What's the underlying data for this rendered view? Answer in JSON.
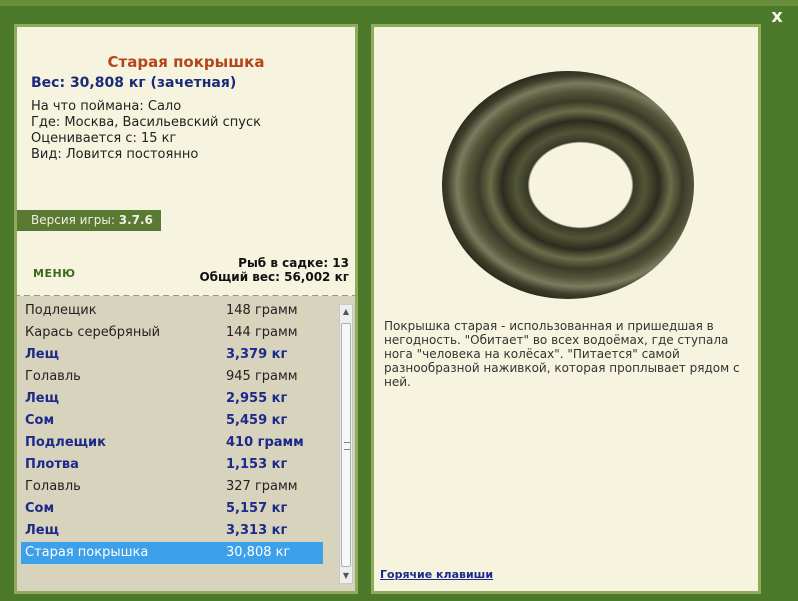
{
  "window": {
    "close_label": "x"
  },
  "fish": {
    "title": "Старая покрышка",
    "weight": "Вес: 30,808 кг (зачетная)",
    "bait": "На что поймана: Сало",
    "place": "Где: Москва, Васильевский спуск",
    "valued_from": "Оценивается с: 15 кг",
    "kind": "Вид: Ловится постоянно"
  },
  "version": {
    "label": "Версия игры:",
    "value": "3.7.6"
  },
  "menu": {
    "label": "МЕНЮ"
  },
  "keep_net": {
    "count": "Рыб в садке: 13",
    "total": "Общий вес: 56,002 кг"
  },
  "catch_list": [
    {
      "name": "Подлещик",
      "weight": "148 грамм",
      "bold": false
    },
    {
      "name": "Карась серебряный",
      "weight": "144 грамм",
      "bold": false
    },
    {
      "name": "Лещ",
      "weight": "3,379 кг",
      "bold": true
    },
    {
      "name": "Голавль",
      "weight": "945 грамм",
      "bold": false
    },
    {
      "name": "Лещ",
      "weight": "2,955 кг",
      "bold": true
    },
    {
      "name": "Сом",
      "weight": "5,459 кг",
      "bold": true
    },
    {
      "name": "Подлещик",
      "weight": "410 грамм",
      "bold": true
    },
    {
      "name": "Плотва",
      "weight": "1,153 кг",
      "bold": true
    },
    {
      "name": "Голавль",
      "weight": "327 грамм",
      "bold": false
    },
    {
      "name": "Сом",
      "weight": "5,157 кг",
      "bold": true
    },
    {
      "name": "Лещ",
      "weight": "3,313 кг",
      "bold": true
    },
    {
      "name": "Старая покрышка",
      "weight": "30,808 кг",
      "bold": false,
      "selected": true
    }
  ],
  "description": "Покрышка старая - использованная и пришедшая в негодность. \"Обитает\" во всех водоёмах, где ступала нога \"человека на колёсах\". \"Питается\" самой разнообразной наживкой, которая проплывает рядом с ней.",
  "hotkeys": {
    "label": "Горячие клавиши"
  },
  "image": {
    "icon": "tire-image"
  }
}
